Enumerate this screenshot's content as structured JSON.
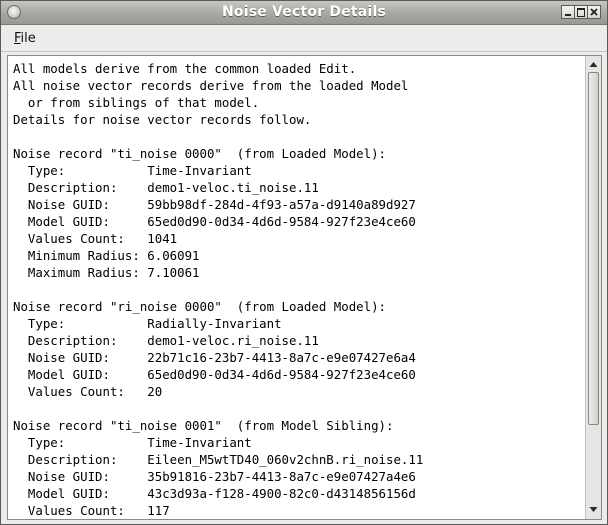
{
  "window": {
    "title": "Noise Vector Details"
  },
  "menubar": {
    "file_label": "File",
    "file_mnemonic": "F",
    "file_rest": "ile"
  },
  "content": {
    "lines": [
      "All models derive from the common loaded Edit.",
      "All noise vector records derive from the loaded Model",
      "  or from siblings of that model.",
      "Details for noise vector records follow.",
      "",
      "Noise record \"ti_noise 0000\"  (from Loaded Model):",
      "  Type:           Time-Invariant",
      "  Description:    demo1-veloc.ti_noise.11",
      "  Noise GUID:     59bb98df-284d-4f93-a57a-d9140a89d927",
      "  Model GUID:     65ed0d90-0d34-4d6d-9584-927f23e4ce60",
      "  Values Count:   1041",
      "  Minimum Radius: 6.06091",
      "  Maximum Radius: 7.10061",
      "",
      "Noise record \"ri_noise 0000\"  (from Loaded Model):",
      "  Type:           Radially-Invariant",
      "  Description:    demo1-veloc.ri_noise.11",
      "  Noise GUID:     22b71c16-23b7-4413-8a7c-e9e07427e6a4",
      "  Model GUID:     65ed0d90-0d34-4d6d-9584-927f23e4ce60",
      "  Values Count:   20",
      "",
      "Noise record \"ti_noise 0001\"  (from Model Sibling):",
      "  Type:           Time-Invariant",
      "  Description:    Eileen_M5wtTD40_060v2chnB.ri_noise.11",
      "  Noise GUID:     35b91816-23b7-4413-8a7c-e9e07427a4e6",
      "  Model GUID:     43c3d93a-f128-4900-82c0-d4314856156d",
      "  Values Count:   117"
    ]
  },
  "scrollbar": {
    "position_fraction": 0.0,
    "visible_fraction": 0.82
  },
  "icons": {
    "system_menu": "circle-icon",
    "minimize": "minimize-icon",
    "maximize": "maximize-icon",
    "close": "close-icon",
    "scroll_up": "arrow-up-icon",
    "scroll_down": "arrow-down-icon"
  }
}
